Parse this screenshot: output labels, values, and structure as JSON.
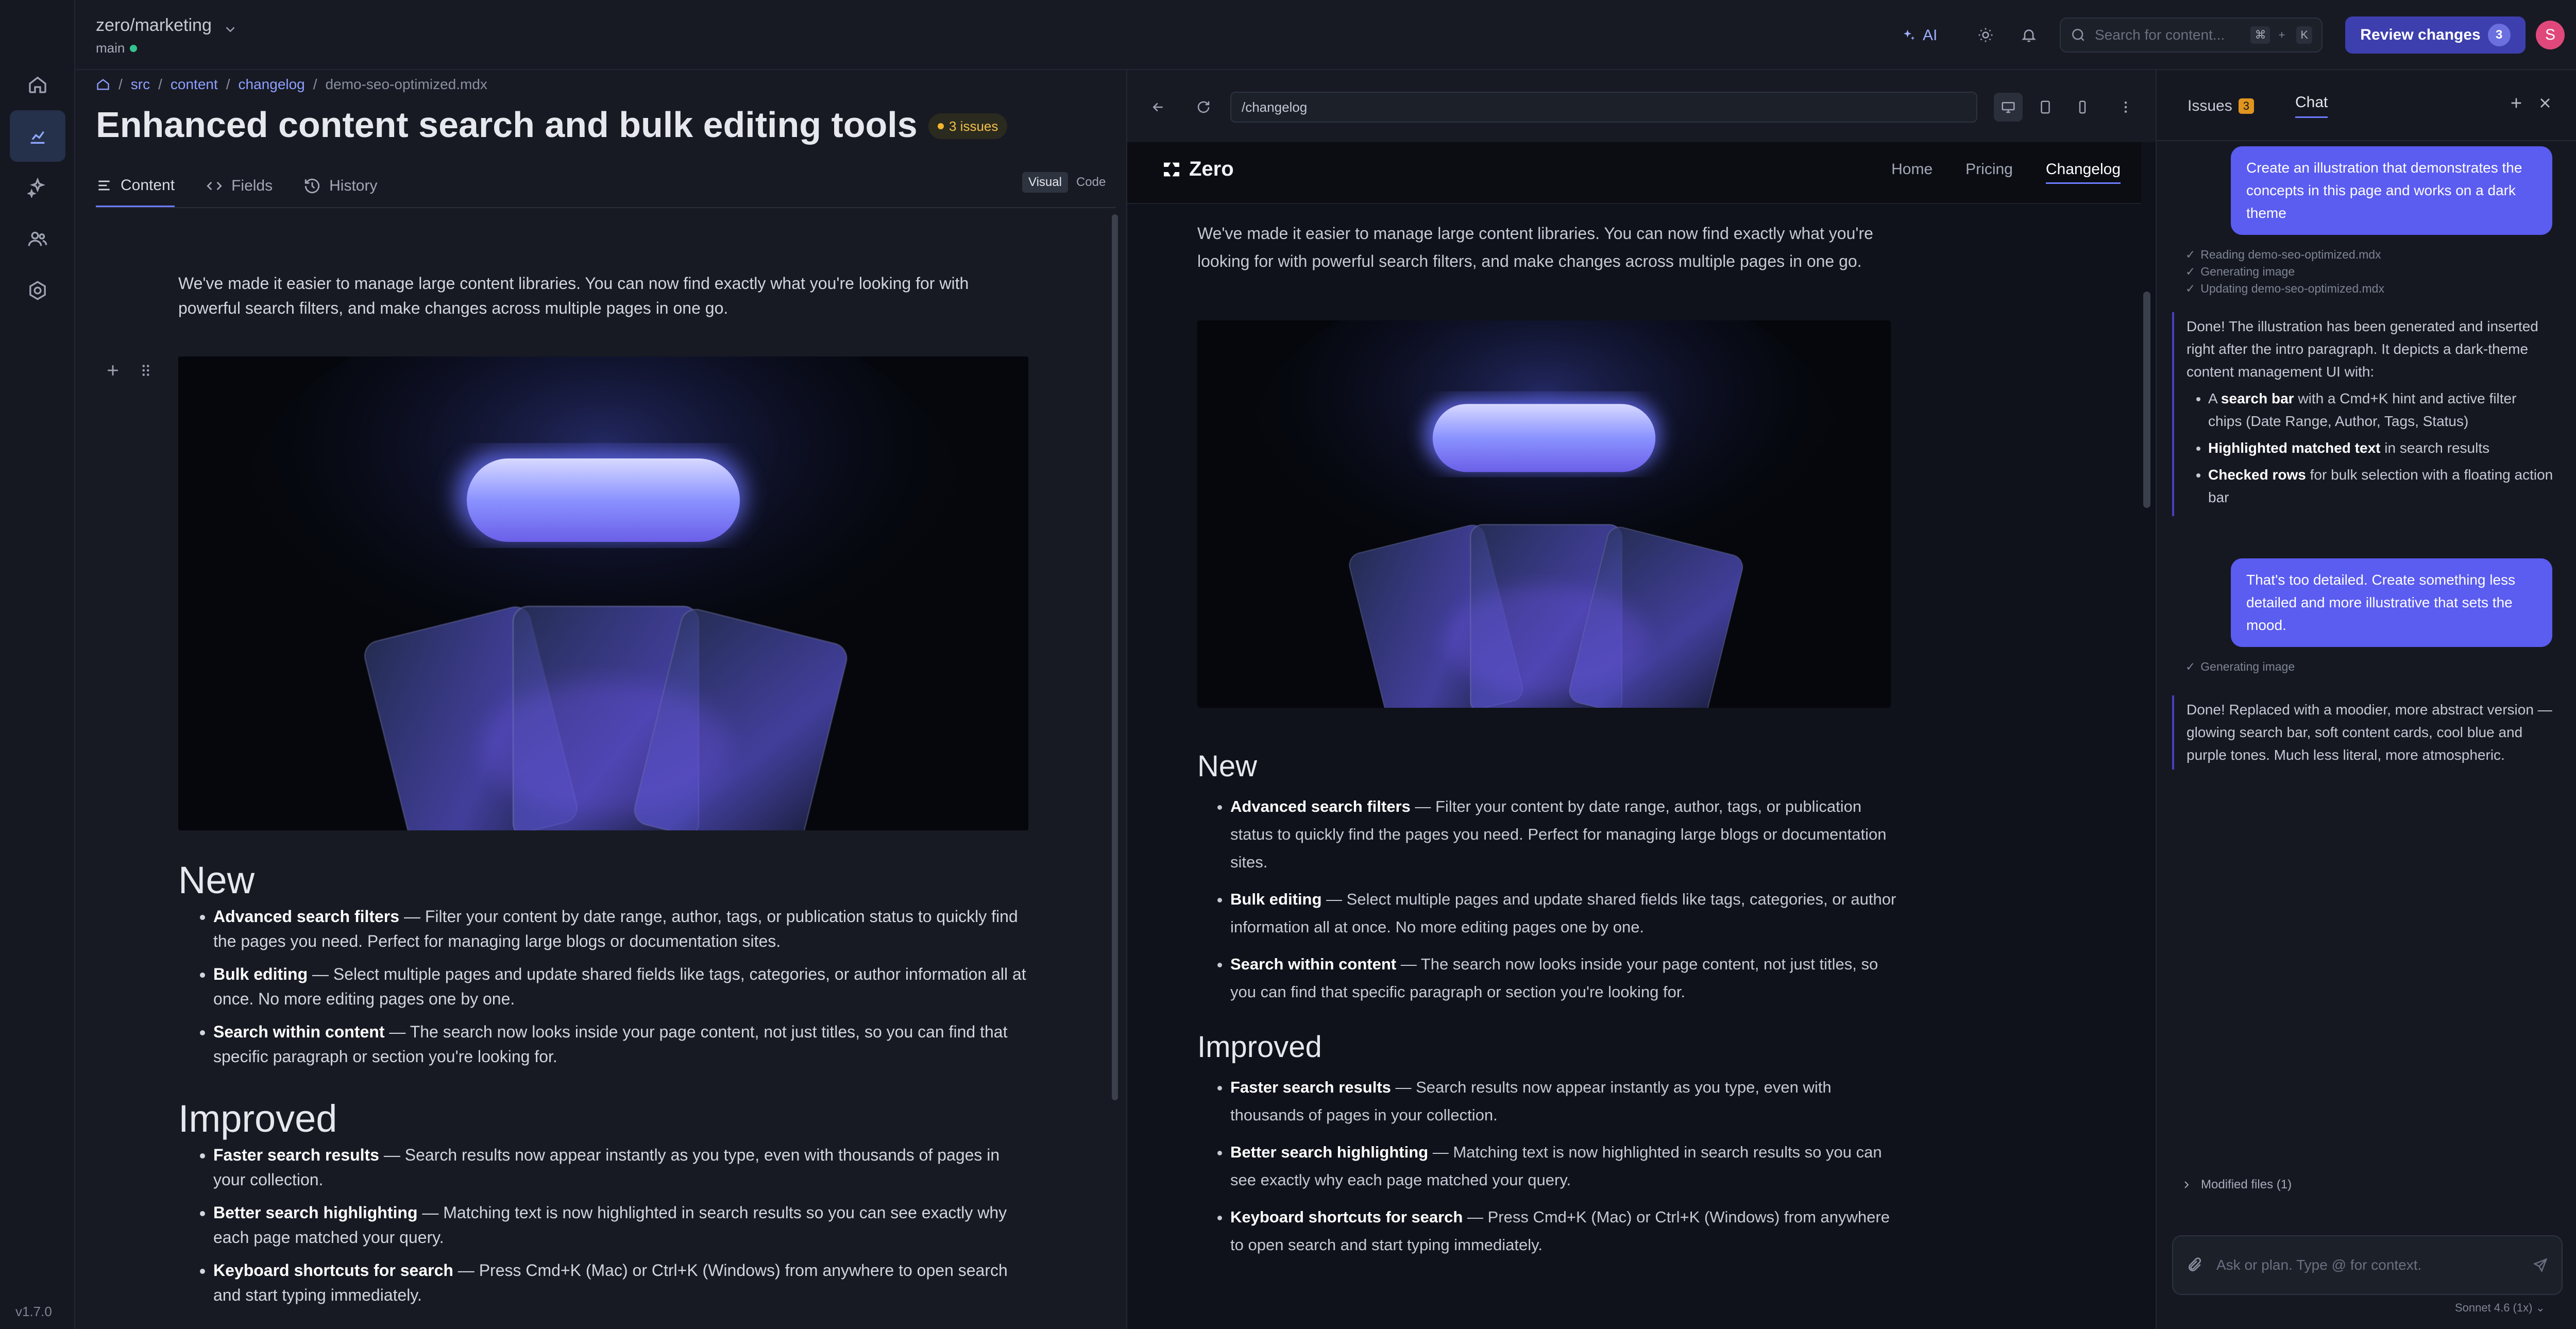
{
  "app": {
    "version": "v1.7.0"
  },
  "rail": [
    "home-icon",
    "analytics-icon",
    "ai-agents-icon",
    "users-icon",
    "settings-icon"
  ],
  "topbar": {
    "repo": "zero/marketing",
    "branch": "main",
    "ai_label": "AI",
    "search_placeholder": "Search for content...",
    "kbd1": "⌘",
    "kbd_plus": "+",
    "kbd2": "K",
    "review_label": "Review changes",
    "review_count": "3",
    "avatar_initial": "S"
  },
  "breadcrumb": {
    "c1": "src",
    "c2": "content",
    "c3": "changelog",
    "current": "demo-seo-optimized.mdx"
  },
  "doc": {
    "title": "Enhanced content search and bulk editing tools",
    "issues_label": "3 issues",
    "tabs": [
      "Content",
      "Fields",
      "History"
    ],
    "mode_visual": "Visual",
    "mode_code": "Code",
    "intro": "We've made it easier to manage large content libraries. You can now find exactly what you're looking for with powerful search filters, and make changes across multiple pages in one go.",
    "h_new": "New",
    "h_improved": "Improved",
    "new_items": [
      {
        "bold": "Advanced search filters",
        "text": " — Filter your content by date range, author, tags, or publication status to quickly find the pages you need. Perfect for managing large blogs or documentation sites."
      },
      {
        "bold": "Bulk editing",
        "text": " — Select multiple pages and update shared fields like tags, categories, or author information all at once. No more editing pages one by one."
      },
      {
        "bold": "Search within content",
        "text": " — The search now looks inside your page content, not just titles, so you can find that specific paragraph or section you're looking for."
      }
    ],
    "improved_items": [
      {
        "bold": "Faster search results",
        "text": " — Search results now appear instantly as you type, even with thousands of pages in your collection."
      },
      {
        "bold": "Better search highlighting",
        "text": " — Matching text is now highlighted in search results so you can see exactly why each page matched your query."
      },
      {
        "bold": "Keyboard shortcuts for search",
        "text": " — Press Cmd+K (Mac) or Ctrl+K (Windows) from anywhere to open search and start typing immediately."
      }
    ]
  },
  "preview": {
    "url": "/changelog",
    "logo": "Zero",
    "nav": [
      "Home",
      "Pricing",
      "Changelog"
    ]
  },
  "panel": {
    "tab_issues": "Issues",
    "issues_count": "3",
    "tab_chat": "Chat",
    "msg1": "Create an illustration that demonstrates the concepts in this page and works on a dark theme",
    "steps1": [
      "Reading demo-seo-optimized.mdx",
      "Generating image",
      "Updating demo-seo-optimized.mdx"
    ],
    "reply1_intro": "Done! The illustration has been generated and inserted right after the intro paragraph. It depicts a dark-theme content management UI with:",
    "reply1_items": [
      {
        "pre": "A ",
        "bold": "search bar",
        "text": " with a Cmd+K hint and active filter chips (Date Range, Author, Tags, Status)"
      },
      {
        "pre": "",
        "bold": "Highlighted matched text",
        "text": " in search results"
      },
      {
        "pre": "",
        "bold": "Checked rows",
        "text": " for bulk selection with a floating action bar"
      }
    ],
    "msg2": "That's too detailed. Create something less detailed and more illustrative that sets the mood.",
    "steps2": [
      "Generating image"
    ],
    "reply2": "Done! Replaced with a moodier, more abstract version — glowing search bar, soft content cards, cool blue and purple tones. Much less literal, more atmospheric.",
    "modified": "Modified files (1)",
    "input_placeholder": "Ask or plan. Type @ for context.",
    "model": "Sonnet 4.6 (1x)"
  },
  "colors": {
    "accent": "#5b5cf0",
    "review": "#3d3fae",
    "warning": "#e0951f",
    "success": "#34c38f"
  }
}
